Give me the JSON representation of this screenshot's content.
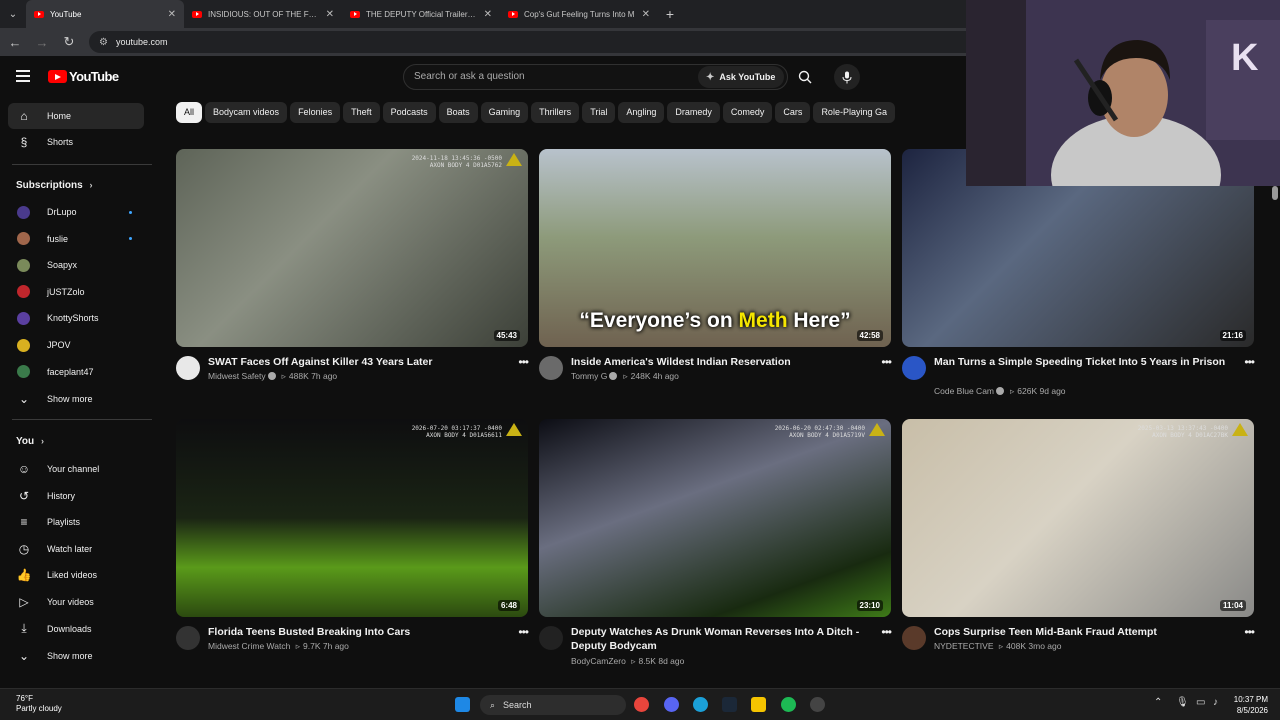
{
  "browser": {
    "tabs": [
      {
        "title": "YouTube",
        "active": true
      },
      {
        "title": "INSIDIOUS: OUT OF THE FURTH",
        "active": false
      },
      {
        "title": "THE DEPUTY Official Trailer (20",
        "active": false
      },
      {
        "title": "Cop's Gut Feeling Turns Into M",
        "active": false
      }
    ],
    "url": "youtube.com"
  },
  "masthead": {
    "logo_text": "YouTube",
    "search_placeholder": "Search or ask a question",
    "ask_label": "Ask YouTube"
  },
  "sidebar": {
    "main": [
      {
        "label": "Home",
        "icon": "home-icon",
        "active": true
      },
      {
        "label": "Shorts",
        "icon": "shorts-icon",
        "active": false
      }
    ],
    "subscriptions_heading": "Subscriptions",
    "subscriptions": [
      {
        "label": "DrLupo",
        "color": "#4a3a8c",
        "dot": true
      },
      {
        "label": "fuslie",
        "color": "#a0664b",
        "dot": true
      },
      {
        "label": "Soapyx",
        "color": "#7a8a5a",
        "dot": false
      },
      {
        "label": "jUSTZolo",
        "color": "#c0262c",
        "dot": false
      },
      {
        "label": "KnottyShorts",
        "color": "#5a3fa0",
        "dot": false
      },
      {
        "label": "JPOV",
        "color": "#d8b020",
        "dot": false
      },
      {
        "label": "faceplant47",
        "color": "#3a7a4a",
        "dot": false
      }
    ],
    "show_more_1": "Show more",
    "you_heading": "You",
    "you_items": [
      {
        "label": "Your channel",
        "icon": "person-icon"
      },
      {
        "label": "History",
        "icon": "history-icon"
      },
      {
        "label": "Playlists",
        "icon": "playlists-icon"
      },
      {
        "label": "Watch later",
        "icon": "clock-icon"
      },
      {
        "label": "Liked videos",
        "icon": "thumbs-up-icon"
      },
      {
        "label": "Your videos",
        "icon": "video-icon"
      },
      {
        "label": "Downloads",
        "icon": "download-icon"
      }
    ],
    "show_more_2": "Show more"
  },
  "chips": [
    "All",
    "Bodycam videos",
    "Felonies",
    "Theft",
    "Podcasts",
    "Boats",
    "Gaming",
    "Thrillers",
    "Trial",
    "Angling",
    "Dramedy",
    "Comedy",
    "Cars",
    "Role-Playing Ga"
  ],
  "videos": [
    {
      "title": "SWAT Faces Off Against Killer 43 Years Later",
      "channel": "Midwest Safety",
      "verified": true,
      "views": "488K",
      "age": "7h ago",
      "duration": "45:43",
      "stamp": "2024-11-18 13:45:36 -0500\nAXON BODY 4 D01A5762",
      "bg": "linear-gradient(135deg,#5e6458 0%,#8a8f82 40%,#3c4038 100%)",
      "avatar": "#e8e8e8"
    },
    {
      "title": "Inside America's Wildest Indian Reservation",
      "channel": "Tommy G",
      "verified": true,
      "views": "248K",
      "age": "4h ago",
      "duration": "42:58",
      "caption": "“Everyone’s on Meth Here”",
      "caption_hl": "Meth",
      "bg": "linear-gradient(180deg,#b8c2cc 0%,#8d9a7a 45%,#6f6250 100%)",
      "avatar": "#6a6a6a"
    },
    {
      "title": "Man Turns a Simple Speeding Ticket Into 5 Years in Prison",
      "channel": "Code Blue Cam",
      "verified": true,
      "views": "626K",
      "age": "9d ago",
      "duration": "21:16",
      "bg": "linear-gradient(135deg,#1d2440 0%,#5a6880 40%,#2a2a2a 100%)",
      "avatar": "#2a56c6"
    },
    {
      "title": "Florida Teens Busted Breaking Into Cars",
      "channel": "Midwest Crime Watch",
      "verified": false,
      "views": "9.7K",
      "age": "7h ago",
      "duration": "6:48",
      "stamp": "2026-07-20 03:17:37 -0400\nAXON BODY 4 D01A56611",
      "bg": "linear-gradient(180deg,#0e0e10 0%,#1a2414 50%,#5a9a1a 75%,#2c4a10 100%)",
      "avatar": "#333"
    },
    {
      "title": "Deputy Watches As Drunk Woman Reverses Into A Ditch - Deputy Bodycam",
      "channel": "BodyCamZero",
      "verified": false,
      "views": "8.5K",
      "age": "8d ago",
      "duration": "23:10",
      "stamp": "2026-06-20 02:47:30 -0400\nAXON BODY 4 D01A5719V",
      "bg": "linear-gradient(160deg,#0c0d14 0%,#6a6e80 40%,#182a10 80%,#3e7a18 100%)",
      "avatar": "#222"
    },
    {
      "title": "Cops Surprise Teen Mid-Bank Fraud Attempt",
      "channel": "NYDETECTIVE",
      "verified": false,
      "views": "408K",
      "age": "3mo ago",
      "duration": "11:04",
      "stamp": "2025-03-13 13:37:43 -0400\nAXON BODY 4 D01AC27BK",
      "bg": "linear-gradient(135deg,#c8bea8 0%,#d8d2c4 45%,#8a8a88 100%)",
      "avatar": "#5a3a2a"
    }
  ],
  "taskbar": {
    "weather_temp": "76°F",
    "weather_desc": "Partly cloudy",
    "search_label": "Search",
    "time": "10:37 PM",
    "date": "8/5/2026"
  }
}
